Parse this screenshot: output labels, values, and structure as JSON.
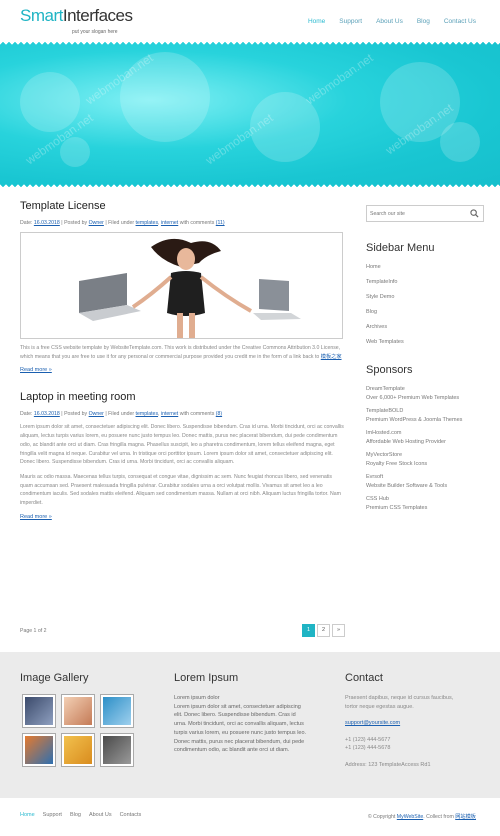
{
  "header": {
    "logo_part1": "Smart",
    "logo_part2": "Interfaces",
    "slogan": "put your slogan here",
    "nav": [
      "Home",
      "Support",
      "About Us",
      "Blog",
      "Contact Us"
    ]
  },
  "banner": {
    "watermark": "webmoban.net"
  },
  "posts": [
    {
      "title": "Template License",
      "meta_date_prefix": "Date:",
      "meta_date": "16.03.2018",
      "meta_posted": "Posted by",
      "meta_author": "Owner",
      "meta_filed": "Filed under",
      "meta_cat1": "templates",
      "meta_cat2": "internet",
      "meta_with": "with comments",
      "meta_comments": "(11)",
      "body": "This is a free CSS website template by WebsiteTemplate.com. This work is distributed under the Creative Commons Attribution 3.0 License, which means that you are free to use it for any personal or commercial purpose provided you credit me in the form of a link back to",
      "body_link": "模板之家",
      "readmore": "Read more »"
    },
    {
      "title": "Laptop in meeting room",
      "meta_date_prefix": "Date:",
      "meta_date": "16.03.2018",
      "meta_posted": "Posted by",
      "meta_author": "Owner",
      "meta_filed": "Filed under",
      "meta_cat1": "templates",
      "meta_cat2": "internet",
      "meta_with": "with comments",
      "meta_comments": "(8)",
      "body1": "Lorem ipsum dolor sit amet, consectetuer adipiscing elit. Donec libero. Suspendisse bibendum. Cras id urna. Morbi tincidunt, orci ac convallis aliquam, lectus turpis varius lorem, eu posuere nunc justo tempus leo. Donec mattis, purus nec placerat bibendum, dui pede condimentum odio, ac blandit ante orci ut diam. Cras fringilla magna. Phasellus suscipit, leo a pharetra condimentum, lorem tellus eleifend magna, eget fringilla velit magna id neque. Curabitur vel urna. In tristique orci porttitor ipsum. Lorem ipsum dolor sit amet, consectetuer adipiscing elit. Donec libero. Suspendisse bibendum. Cras id urna. Morbi tincidunt, orci ac convallis aliquam.",
      "body2": "Mauris ac odio massa. Maecenas tellus turpis, consequat et congue vitae, dignissim ac sem. Nunc feugiat rhoncus libero, sed venenatis quam accumsan sed. Praesent malesuada fringilla pulvinar. Curabitur sodales urna a orci volutpat mollis. Vivamus sit amet leo a leo condimentum iaculis. Sed sodales mattis eleifend. Aliquam sed condimentum massa. Nullam at orci nibh. Aliquam luctus fringilla tortor. Nam imperdiet.",
      "readmore": "Read more »"
    }
  ],
  "pager": {
    "label": "Page 1 of 2",
    "pages": [
      "1",
      "2",
      "»"
    ]
  },
  "sidebar": {
    "search_placeholder": "Search our site",
    "menu_title": "Sidebar Menu",
    "menu": [
      "Home",
      "TemplateInfo",
      "Style Demo",
      "Blog",
      "Archives",
      "Web Templates"
    ],
    "sponsors_title": "Sponsors",
    "sponsors": [
      {
        "title": "DreamTemplate",
        "desc": "Over 6,000+ Premium Web Templates"
      },
      {
        "title": "TemplateBOLD",
        "desc": "Premium WordPress & Joomla Themes"
      },
      {
        "title": "ImHosted.com",
        "desc": "Affordable Web Hosting Provider"
      },
      {
        "title": "MyVectorStore",
        "desc": "Royalty Free Stock Icons"
      },
      {
        "title": "Evrsoft",
        "desc": "Website Builder Software & Tools"
      },
      {
        "title": "CSS Hub",
        "desc": "Premium CSS Templates"
      }
    ]
  },
  "footer": {
    "gallery_title": "Image Gallery",
    "lorem_title": "Lorem Ipsum",
    "lorem_lines": [
      "Lorem ipsum dolor",
      "Lorem ipsum dolor sit amet, consectetuer adipiscing",
      "elit. Donec libero. Suspendisse bibendum. Cras id",
      "urna. Morbi tincidunt, orci ac convallis aliquam, lectus",
      "turpis varius lorem, eu posuere nunc justo tempus leo.",
      "Donec mattis, purus nec placerat bibendum, dui pede",
      "condimentum odio, ac blandit ante orci ut diam."
    ],
    "contact_title": "Contact",
    "contact_text1": "Praesent dapibus, neque id cursus faucibus,",
    "contact_text2": "tortor neque egestas augue.",
    "contact_email": "support@yoursite.com",
    "contact_phone1": "+1 (123) 444-5677",
    "contact_phone2": "+1 (123) 444-5678",
    "contact_address": "Address: 123 TemplateAccess Rd1"
  },
  "bottom": {
    "nav": [
      "Home",
      "Support",
      "Blog",
      "About Us",
      "Contacts"
    ],
    "copyright_prefix": "© Copyright",
    "copyright_link": "MyWebSite",
    "collect_prefix": ". Collect from",
    "collect_link": "网站模板"
  },
  "colors": {
    "accent": "#1fb4c4",
    "banner": "#19c6d2",
    "link": "#1a5fb0"
  }
}
